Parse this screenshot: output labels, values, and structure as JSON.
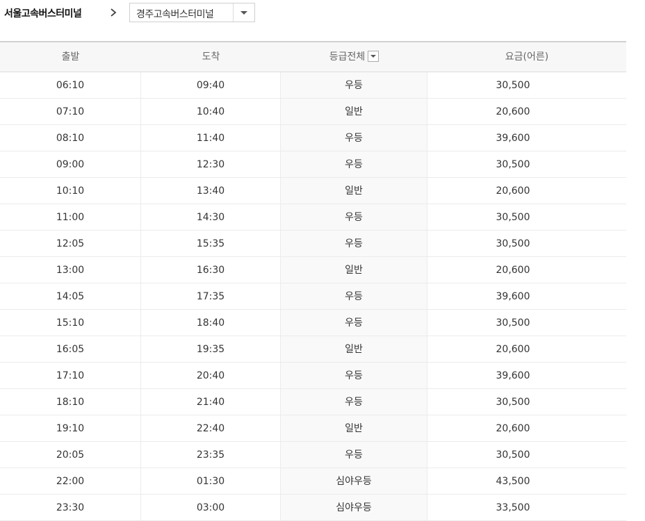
{
  "route": {
    "origin": "서울고속버스터미널",
    "separator_icon": "chevron-right-icon",
    "destination": "경주고속버스터미널",
    "destination_dropdown_icon": "caret-down-icon"
  },
  "table": {
    "headers": {
      "departure": "출발",
      "arrival": "도착",
      "grade": "등급전체",
      "fare": "요금(어른)"
    },
    "rows": [
      {
        "departure": "06:10",
        "arrival": "09:40",
        "grade": "우등",
        "fare": "30,500"
      },
      {
        "departure": "07:10",
        "arrival": "10:40",
        "grade": "일반",
        "fare": "20,600"
      },
      {
        "departure": "08:10",
        "arrival": "11:40",
        "grade": "우등",
        "fare": "39,600"
      },
      {
        "departure": "09:00",
        "arrival": "12:30",
        "grade": "우등",
        "fare": "30,500"
      },
      {
        "departure": "10:10",
        "arrival": "13:40",
        "grade": "일반",
        "fare": "20,600"
      },
      {
        "departure": "11:00",
        "arrival": "14:30",
        "grade": "우등",
        "fare": "30,500"
      },
      {
        "departure": "12:05",
        "arrival": "15:35",
        "grade": "우등",
        "fare": "30,500"
      },
      {
        "departure": "13:00",
        "arrival": "16:30",
        "grade": "일반",
        "fare": "20,600"
      },
      {
        "departure": "14:05",
        "arrival": "17:35",
        "grade": "우등",
        "fare": "39,600"
      },
      {
        "departure": "15:10",
        "arrival": "18:40",
        "grade": "우등",
        "fare": "30,500"
      },
      {
        "departure": "16:05",
        "arrival": "19:35",
        "grade": "일반",
        "fare": "20,600"
      },
      {
        "departure": "17:10",
        "arrival": "20:40",
        "grade": "우등",
        "fare": "39,600"
      },
      {
        "departure": "18:10",
        "arrival": "21:40",
        "grade": "우등",
        "fare": "30,500"
      },
      {
        "departure": "19:10",
        "arrival": "22:40",
        "grade": "일반",
        "fare": "20,600"
      },
      {
        "departure": "20:05",
        "arrival": "23:35",
        "grade": "우등",
        "fare": "30,500"
      },
      {
        "departure": "22:00",
        "arrival": "01:30",
        "grade": "심야우등",
        "fare": "43,500"
      },
      {
        "departure": "23:30",
        "arrival": "03:00",
        "grade": "심야우등",
        "fare": "33,500"
      }
    ]
  }
}
